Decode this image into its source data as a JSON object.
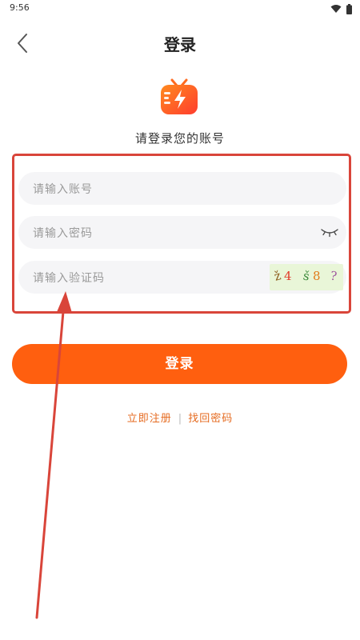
{
  "status_bar": {
    "time": "9:56",
    "icons": [
      "wifi-icon",
      "battery-icon"
    ]
  },
  "header": {
    "title": "登录",
    "back_icon": "chevron-left-icon"
  },
  "logo": {
    "icon": "tv-lightning-logo",
    "color": "#ff5a1f"
  },
  "subtitle": "请登录您的账号",
  "form": {
    "account_placeholder": "请输入账号",
    "account_value": "",
    "password_placeholder": "请输入密码",
    "password_value": "",
    "captcha_placeholder": "请输入验证码",
    "captcha_value": "",
    "captcha_chars": [
      "ž",
      "4",
      "š",
      "8",
      "?"
    ]
  },
  "login_button": "登录",
  "links": {
    "register": "立即注册",
    "separator": "|",
    "recover": "找回密码"
  },
  "colors": {
    "primary": "#ff5f0f",
    "annotation": "#d9453a",
    "link": "#e56a1f"
  }
}
